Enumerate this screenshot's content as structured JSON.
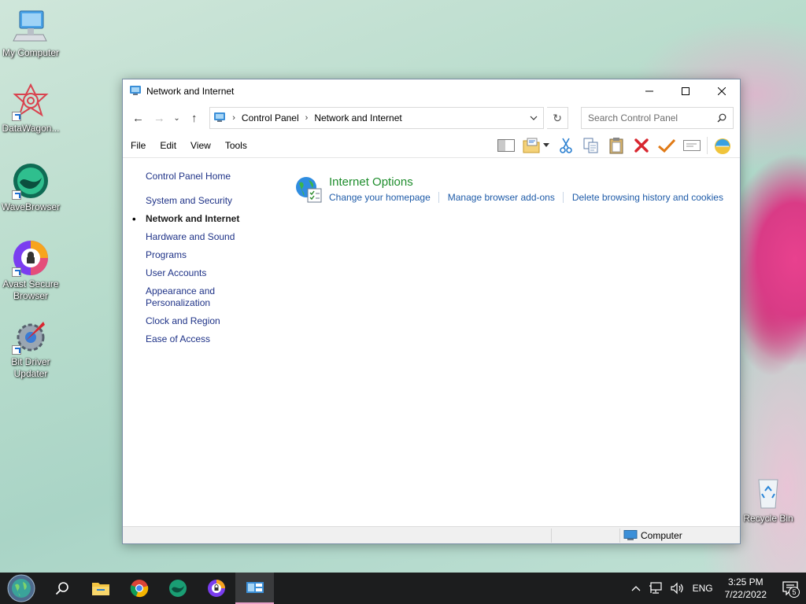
{
  "desktop": {
    "icons": [
      {
        "label": "My Computer"
      },
      {
        "label": "DataWagon..."
      },
      {
        "label": "WaveBrowser"
      },
      {
        "label": "Avast Secure Browser"
      },
      {
        "label": "Bit Driver Updater"
      },
      {
        "label": "Recycle Bin"
      }
    ]
  },
  "window": {
    "title": "Network and Internet",
    "breadcrumb": [
      "Control Panel",
      "Network and Internet"
    ],
    "search_placeholder": "Search Control Panel",
    "menu": [
      "File",
      "Edit",
      "View",
      "Tools"
    ],
    "toolbar_icons": [
      "layout-pane-icon",
      "folder-options-icon",
      "cut-icon",
      "copy-icon",
      "paste-icon",
      "delete-icon",
      "checkmark-icon",
      "rename-icon",
      "globe-shell-icon"
    ]
  },
  "sidebar": {
    "home": "Control Panel Home",
    "items": [
      {
        "label": "System and Security",
        "active": false
      },
      {
        "label": "Network and Internet",
        "active": true
      },
      {
        "label": "Hardware and Sound",
        "active": false
      },
      {
        "label": "Programs",
        "active": false
      },
      {
        "label": "User Accounts",
        "active": false
      },
      {
        "label": "Appearance and Personalization",
        "active": false
      },
      {
        "label": "Clock and Region",
        "active": false
      },
      {
        "label": "Ease of Access",
        "active": false
      }
    ]
  },
  "main": {
    "category": {
      "title": "Internet Options",
      "links": [
        "Change your homepage",
        "Manage browser add-ons",
        "Delete browsing history and cookies"
      ]
    }
  },
  "statusbar": {
    "location": "Computer"
  },
  "taskbar": {
    "apps": [
      "start-button",
      "search",
      "file-explorer",
      "chrome",
      "wavebrowser",
      "avast-secure-browser",
      "control-panel"
    ],
    "tray": {
      "language": "ENG",
      "time": "3:25 PM",
      "date": "7/22/2022",
      "notification_count": "5"
    }
  },
  "colors": {
    "accent_link": "#1e5ba8",
    "category_title": "#1e8d2c",
    "nav_link": "#1e3287",
    "taskbar": "#1c1d1e"
  }
}
